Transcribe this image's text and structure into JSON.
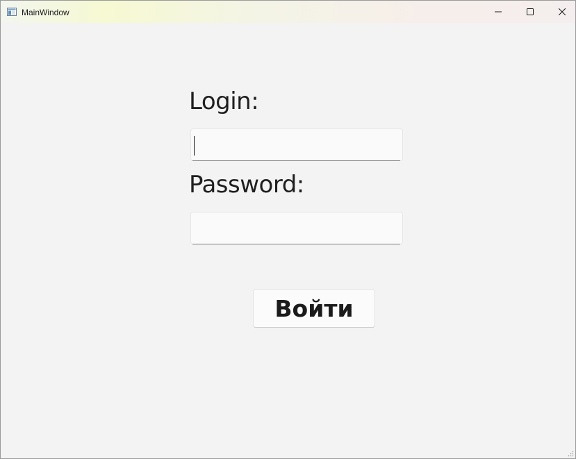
{
  "window": {
    "title": "MainWindow",
    "icon": "app-window-icon",
    "controls": {
      "minimize_icon": "minimize-icon",
      "maximize_icon": "maximize-icon",
      "close_icon": "close-icon"
    }
  },
  "form": {
    "login_label": "Login:",
    "login_value": "",
    "password_label": "Password:",
    "password_value": "",
    "submit_label": "Войти"
  },
  "colors": {
    "background": "#f3f3f3",
    "text": "#1f1f1f",
    "input_background": "#fafafa"
  }
}
